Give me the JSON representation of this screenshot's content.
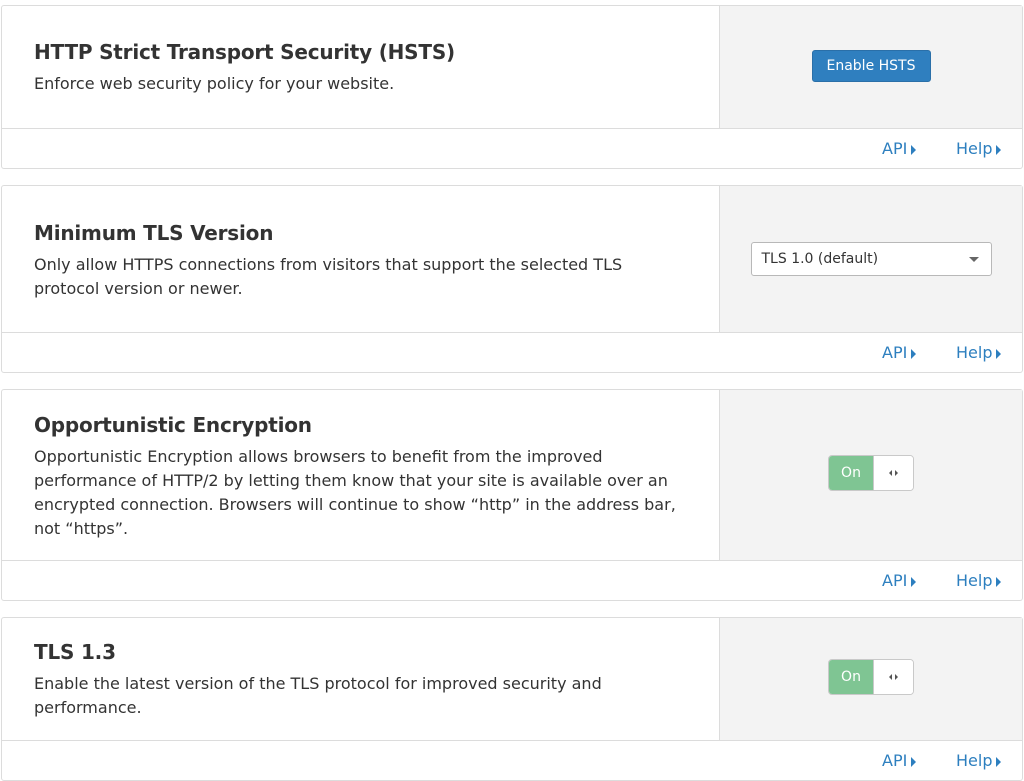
{
  "cards": [
    {
      "title": "HTTP Strict Transport Security (HSTS)",
      "description": "Enforce web security policy for your website.",
      "control": {
        "type": "button",
        "label": "Enable HSTS"
      },
      "links": {
        "api": "API",
        "help": "Help"
      }
    },
    {
      "title": "Minimum TLS Version",
      "description": "Only allow HTTPS connections from visitors that support the selected TLS protocol version or newer.",
      "control": {
        "type": "select",
        "value": "TLS 1.0 (default)"
      },
      "links": {
        "api": "API",
        "help": "Help"
      }
    },
    {
      "title": "Opportunistic Encryption",
      "description": "Opportunistic Encryption allows browsers to benefit from the improved performance of HTTP/2 by letting them know that your site is available over an encrypted connection. Browsers will continue to show “http” in the address bar, not “https”.",
      "control": {
        "type": "toggle",
        "state": "On"
      },
      "links": {
        "api": "API",
        "help": "Help"
      }
    },
    {
      "title": "TLS 1.3",
      "description": "Enable the latest version of the TLS protocol for improved security and performance.",
      "control": {
        "type": "toggle",
        "state": "On"
      },
      "links": {
        "api": "API",
        "help": "Help"
      }
    }
  ],
  "colors": {
    "link": "#2d7fbf",
    "primary_button": "#2f7fbf",
    "toggle_on": "#7fc593",
    "side_panel": "#f3f3f3",
    "border": "#dcdcdc"
  }
}
